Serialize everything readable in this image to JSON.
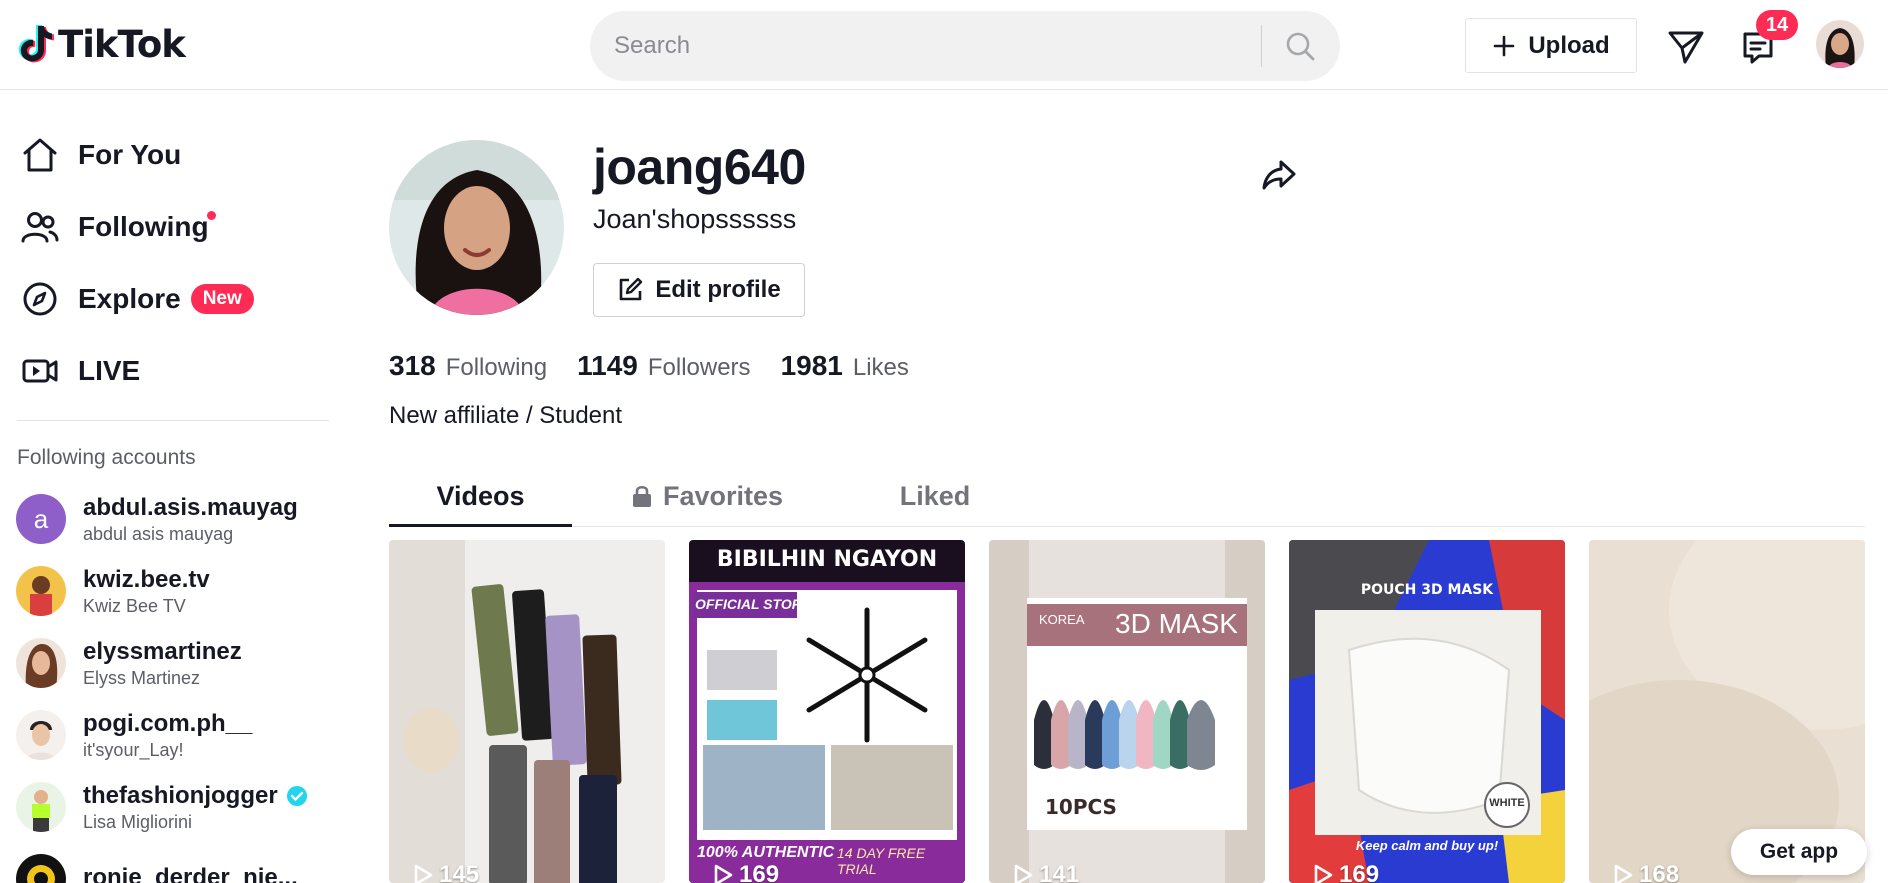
{
  "app": {
    "logo_text": "TikTok"
  },
  "header": {
    "search_placeholder": "Search",
    "upload_label": "Upload",
    "inbox_badge": "14"
  },
  "sidebar": {
    "nav": [
      {
        "label": "For You",
        "icon": "home-icon"
      },
      {
        "label": "Following",
        "icon": "following-icon",
        "has_dot": true
      },
      {
        "label": "Explore",
        "icon": "compass-icon",
        "badge": "New"
      },
      {
        "label": "LIVE",
        "icon": "live-icon"
      }
    ],
    "heading": "Following accounts",
    "accounts": [
      {
        "username": "abdul.asis.mauyag",
        "name": "abdul asis mauyag",
        "avatar_letter": "a",
        "color": "#8e5fc9"
      },
      {
        "username": "kwiz.bee.tv",
        "name": "Kwiz Bee TV",
        "color": "#e8a33c"
      },
      {
        "username": "elyssmartinez",
        "name": "Elyss Martinez",
        "color": "#c98c72"
      },
      {
        "username": "pogi.com.ph__",
        "name": "it'syour_Lay!",
        "color": "#d8c3b8"
      },
      {
        "username": "thefashionjogger",
        "name": "Lisa Migliorini",
        "verified": true,
        "color": "#7fcf5a"
      },
      {
        "username": "ronie_derder_nie...",
        "name": "",
        "color": "#f0c419"
      }
    ]
  },
  "profile": {
    "username": "joang640",
    "nickname": "Joan'shopssssss",
    "edit_label": "Edit profile",
    "stats": [
      {
        "value": "318",
        "label": "Following"
      },
      {
        "value": "1149",
        "label": "Followers"
      },
      {
        "value": "1981",
        "label": "Likes"
      }
    ],
    "bio": "New affiliate / Student"
  },
  "tabs": [
    {
      "label": "Videos",
      "active": true
    },
    {
      "label": "Favorites",
      "locked": true
    },
    {
      "label": "Liked"
    }
  ],
  "videos": [
    {
      "plays": "145",
      "theme": "pants"
    },
    {
      "plays": "169",
      "theme": "store",
      "text_top": "BIBILHIN NGAYON",
      "text_store": "OFFICIAL STORE",
      "text_bottom": "100% AUTHENTIC",
      "text_trial": "14 DAY FREE TRIAL"
    },
    {
      "plays": "141",
      "theme": "mask",
      "text_label": "3D MASK",
      "text_korea": "KOREA",
      "text_pcs": "10PCS"
    },
    {
      "plays": "169",
      "theme": "pouch",
      "text_title": "POUCH 3D MASK",
      "text_white": "WHITE",
      "text_caption": "Keep calm and buy up!"
    },
    {
      "plays": "168",
      "theme": "plain"
    }
  ],
  "get_app_label": "Get app",
  "colors": {
    "accent": "#fe2c55",
    "text": "#161823",
    "muted": "#5c5e66"
  }
}
